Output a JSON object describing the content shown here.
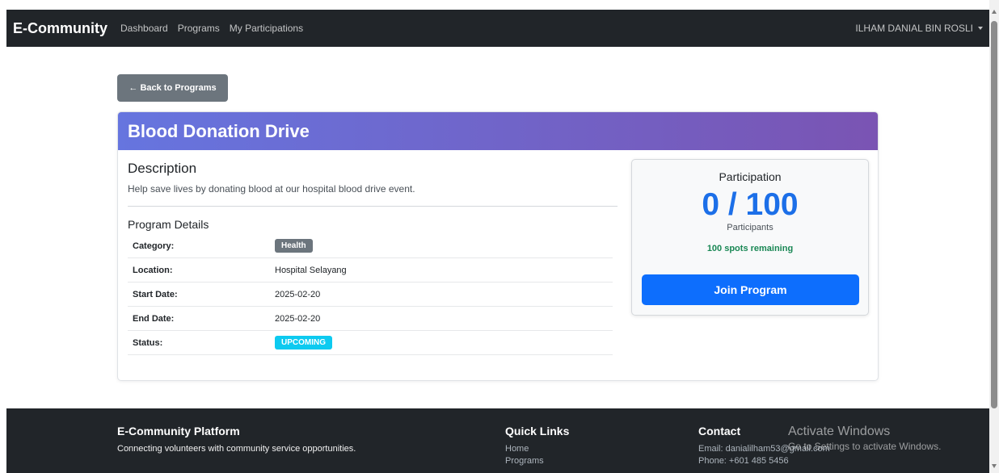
{
  "nav": {
    "brand": "E-Community",
    "links": [
      "Dashboard",
      "Programs",
      "My Participations"
    ],
    "user": "ILHAM DANIAL BIN ROSLI"
  },
  "back_button": "← Back to Programs",
  "program": {
    "title": "Blood Donation Drive",
    "description_heading": "Description",
    "description": "Help save lives by donating blood at our hospital blood drive event.",
    "details_heading": "Program Details",
    "details": [
      {
        "label": "Category:",
        "value": "Health"
      },
      {
        "label": "Location:",
        "value": "Hospital Selayang"
      },
      {
        "label": "Start Date:",
        "value": "2025-02-20"
      },
      {
        "label": "End Date:",
        "value": "2025-02-20"
      },
      {
        "label": "Status:",
        "value": "UPCOMING"
      }
    ]
  },
  "participation": {
    "title": "Participation",
    "count": "0 / 100",
    "label": "Participants",
    "remaining": "100 spots remaining",
    "join_button": "Join Program"
  },
  "footer": {
    "platform_title": "E-Community Platform",
    "platform_text": "Connecting volunteers with community service opportunities.",
    "links_title": "Quick Links",
    "links": [
      "Home",
      "Programs"
    ],
    "contact_title": "Contact",
    "email": "Email: danialilham53@gmail.com",
    "phone": "Phone: +601 485 5456"
  },
  "watermark": {
    "title": "Activate Windows",
    "subtitle": "Go to Settings to activate Windows."
  },
  "colors": {
    "navbar": "#212529",
    "header_gradient_start": "#6675df",
    "header_gradient_end": "#7a54b3",
    "primary": "#0d6efd",
    "count": "#1c6fe8",
    "success": "#198754",
    "status_badge": "#0dcaf0",
    "category_badge": "#6c757d"
  }
}
